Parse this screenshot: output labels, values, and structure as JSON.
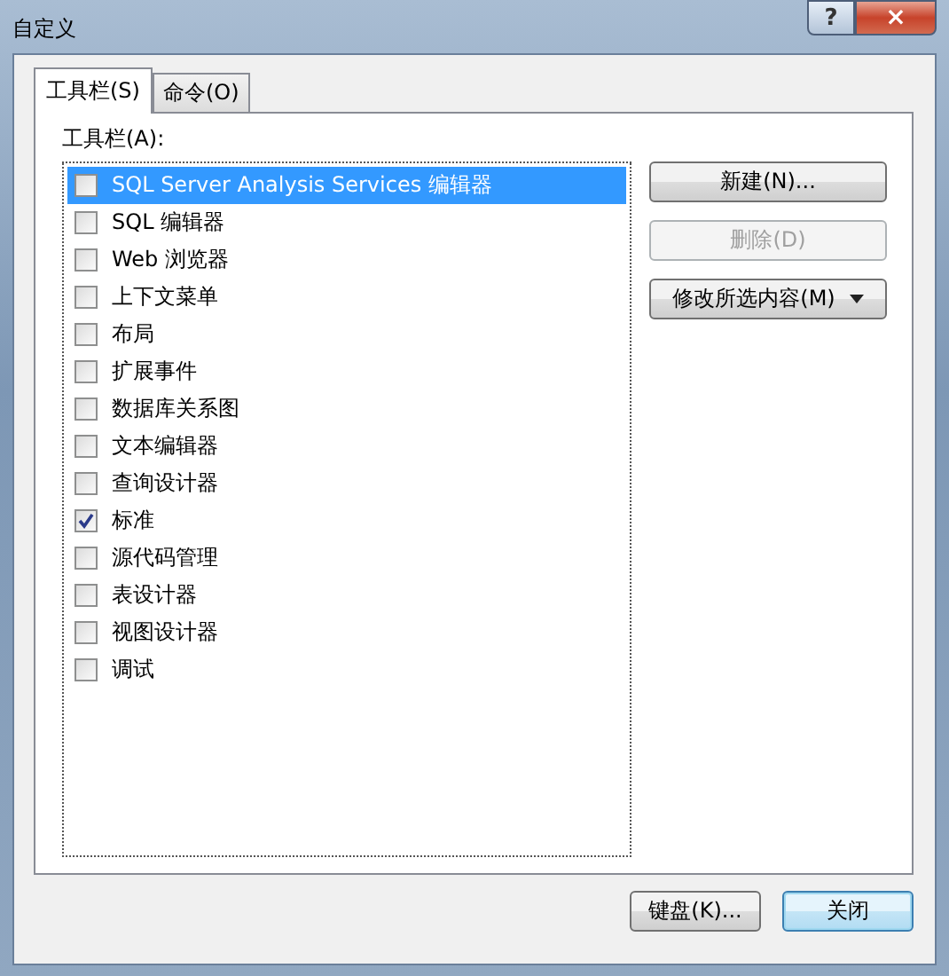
{
  "window": {
    "title": "自定义",
    "title_buttons": [
      {
        "kind": "help",
        "label": "?"
      },
      {
        "kind": "close",
        "label": "×"
      }
    ]
  },
  "tabs": [
    {
      "label": "工具栏(S)",
      "selected": true
    },
    {
      "label": "命令(O)",
      "selected": false
    }
  ],
  "toolbars": {
    "label": "工具栏(A):",
    "items": [
      {
        "label": "SQL Server Analysis Services 编辑器",
        "checked": false,
        "selected": true
      },
      {
        "label": "SQL 编辑器",
        "checked": false,
        "selected": false
      },
      {
        "label": "Web 浏览器",
        "checked": false,
        "selected": false
      },
      {
        "label": "上下文菜单",
        "checked": false,
        "selected": false
      },
      {
        "label": "布局",
        "checked": false,
        "selected": false
      },
      {
        "label": "扩展事件",
        "checked": false,
        "selected": false
      },
      {
        "label": "数据库关系图",
        "checked": false,
        "selected": false
      },
      {
        "label": "文本编辑器",
        "checked": false,
        "selected": false
      },
      {
        "label": "查询设计器",
        "checked": false,
        "selected": false
      },
      {
        "label": "标准",
        "checked": true,
        "selected": false
      },
      {
        "label": "源代码管理",
        "checked": false,
        "selected": false
      },
      {
        "label": "表设计器",
        "checked": false,
        "selected": false
      },
      {
        "label": "视图设计器",
        "checked": false,
        "selected": false
      },
      {
        "label": "调试",
        "checked": false,
        "selected": false
      }
    ]
  },
  "side_buttons": [
    {
      "label": "新建(N)...",
      "disabled": false,
      "dropdown": false
    },
    {
      "label": "删除(D)",
      "disabled": true,
      "dropdown": false
    },
    {
      "label": "修改所选内容(M)",
      "disabled": false,
      "dropdown": true
    }
  ],
  "footer_buttons": [
    {
      "label": "键盘(K)...",
      "default": false
    },
    {
      "label": "关闭",
      "default": true
    }
  ]
}
